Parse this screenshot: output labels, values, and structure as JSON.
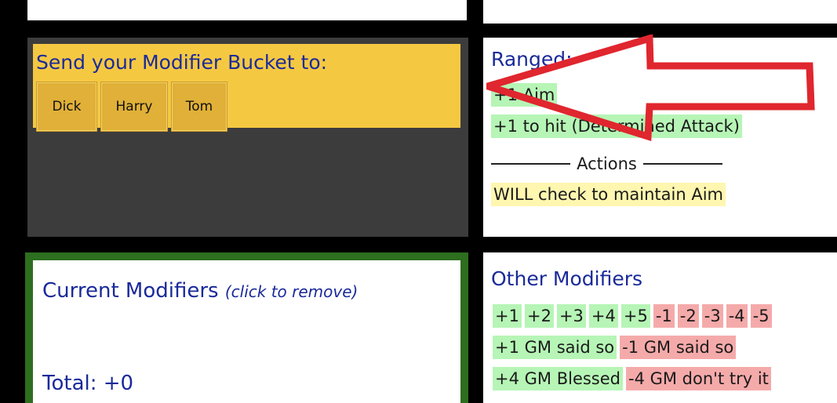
{
  "send_bucket": {
    "title": "Send your Modifier Bucket to:",
    "recipients": [
      "Dick",
      "Harry",
      "Tom"
    ]
  },
  "ranged": {
    "title": "Ranged:",
    "modifiers": [
      "+1 Aim",
      "+1 to hit (Determined Attack)"
    ],
    "actions_label": "Actions",
    "action_items": [
      "WILL check to maintain Aim"
    ]
  },
  "current": {
    "title": "Current Modifiers",
    "hint": "(click to remove)",
    "total_label": "Total:",
    "total_value": "+0"
  },
  "other": {
    "title": "Other Modifiers",
    "quick": {
      "positive": [
        "+1",
        "+2",
        "+3",
        "+4",
        "+5"
      ],
      "negative": [
        "-1",
        "-2",
        "-3",
        "-4",
        "-5"
      ]
    },
    "gm": [
      {
        "positive": "+1 GM said so",
        "negative": "-1 GM said so"
      },
      {
        "positive": "+4 GM Blessed",
        "negative": "-4 GM don't try it"
      }
    ]
  },
  "colors": {
    "title_blue": "#1a2a9a",
    "bucket_yellow": "#f5c842",
    "positive_green": "#b6f5b6",
    "negative_red": "#f5aaaa",
    "action_yellow": "#fff6b0",
    "border_green": "#2d6e1f",
    "annotation_arrow": "#e0262e"
  },
  "annotation": {
    "icon": "red-outline-arrow-icon"
  }
}
